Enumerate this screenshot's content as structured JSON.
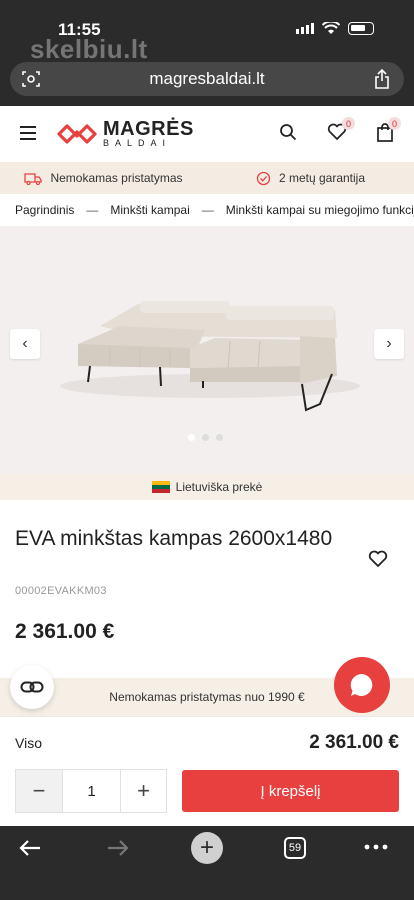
{
  "status_bar": {
    "time": "11:55",
    "watermark": "skelbiu.lt"
  },
  "browser": {
    "url": "magresbaldai.lt",
    "tab_count": "59"
  },
  "header": {
    "logo_word": "MAGRĖS",
    "logo_sub": "BALDAI",
    "wishlist_count": "0",
    "cart_count": "0"
  },
  "benefits": [
    {
      "label": "Nemokamas pristatymas",
      "icon": "truck-icon"
    },
    {
      "label": "2 metų garantija",
      "icon": "check-badge-icon"
    }
  ],
  "breadcrumb": [
    "Pagrindinis",
    "Minkšti kampai",
    "Minkšti kampai su miegojimo funkcija"
  ],
  "gallery": {
    "image": "sofa-photo",
    "slide_count": 3,
    "active_slide": 1
  },
  "origin": {
    "label": "Lietuviška prekė"
  },
  "product": {
    "title": "EVA minkštas kampas 2600x1480",
    "sku": "00002EVAKKM03",
    "price": "2 361.00 €"
  },
  "promo": {
    "text": "Nemokamas pristatymas nuo 1990 €"
  },
  "cart": {
    "total_label": "Viso",
    "total_value": "2 361.00 €",
    "quantity": "1",
    "add_label": "Į krepšelį"
  },
  "colors": {
    "accent": "#e8403e",
    "beige": "#f5efe6",
    "dark": "#2b2b2b"
  }
}
